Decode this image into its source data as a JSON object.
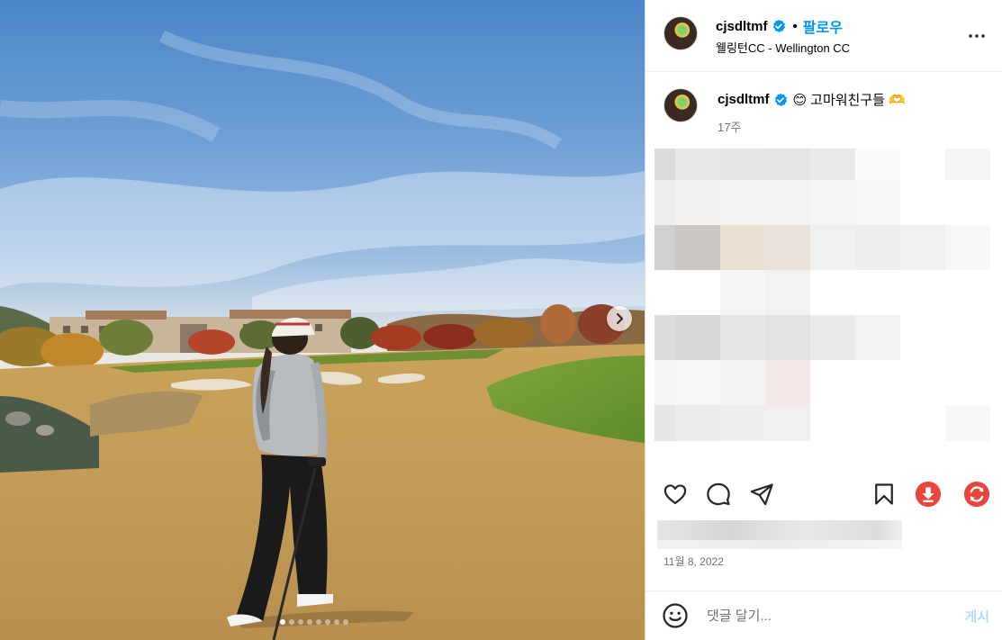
{
  "post": {
    "username": "cjsdltmf",
    "follow_label": "팔로우",
    "bullet": "•",
    "location": "웰링턴CC - Wellington CC",
    "caption_emoji_start": "😊",
    "caption_text": "고마워친구들",
    "caption_emoji_end": "🫶",
    "caption_time": "17주",
    "date": "11월 8, 2022",
    "image_count": 8,
    "active_image_index": 0
  },
  "comment": {
    "placeholder": "댓글 달기...",
    "post_label": "게시"
  },
  "icons": {
    "verified": "verified-badge-icon",
    "more": "more-options-icon",
    "next": "chevron-right-icon",
    "like": "heart-icon",
    "comment": "comment-bubble-icon",
    "share": "paper-plane-icon",
    "save": "bookmark-icon",
    "download": "download-extension-icon",
    "refresh": "refresh-extension-icon",
    "emoji": "smiley-icon"
  },
  "colors": {
    "accent": "#0095f6",
    "post_disabled": "#b3dbff",
    "extension_red": "#e8453c",
    "muted_text": "#737373"
  }
}
